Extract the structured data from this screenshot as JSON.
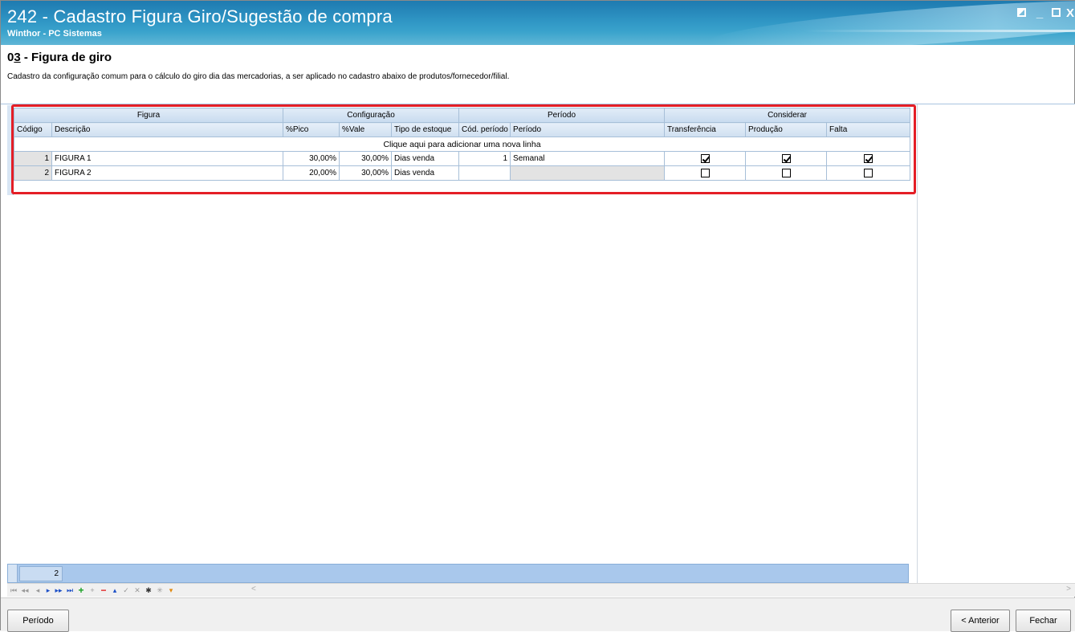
{
  "window": {
    "title": "242 - Cadastro Figura Giro/Sugestão de compra",
    "subtitle": "Winthor - PC Sistemas",
    "controls": {
      "minimize": "_",
      "close": "X"
    }
  },
  "header": {
    "step_prefix": "0",
    "step_underlined": "3",
    "title_rest": " - Figura de giro",
    "description": "Cadastro da configuração comum para o cálculo do giro dia das mercadorias, a ser aplicado no cadastro abaixo de produtos/fornecedor/filial."
  },
  "grid": {
    "bands": [
      "Figura",
      "Configuração",
      "Período",
      "Considerar"
    ],
    "columns": [
      "Código",
      "Descrição",
      "%Pico",
      "%Vale",
      "Tipo de estoque",
      "Cód. período",
      "Período",
      "Transferência",
      "Produção",
      "Falta"
    ],
    "add_row_text": "Clique aqui para adicionar uma nova linha",
    "rows": [
      {
        "codigo": "1",
        "descricao": "FIGURA 1",
        "pico": "30,00%",
        "vale": "30,00%",
        "tipo_estoque": "Dias venda",
        "cod_periodo": "1",
        "periodo": "Semanal",
        "transferencia": true,
        "producao": true,
        "falta": true
      },
      {
        "codigo": "2",
        "descricao": "FIGURA 2",
        "pico": "20,00%",
        "vale": "30,00%",
        "tipo_estoque": "Dias venda",
        "cod_periodo": "",
        "periodo": "",
        "transferencia": false,
        "producao": false,
        "falta": false
      }
    ],
    "footer_count": "2"
  },
  "buttons": {
    "periodo": "Período",
    "anterior": "< Anterior",
    "fechar": "Fechar"
  },
  "colors": {
    "title_bar": "#2f95c4",
    "highlight_frame": "#e41e26",
    "footer_bar": "#a9c8ec"
  }
}
